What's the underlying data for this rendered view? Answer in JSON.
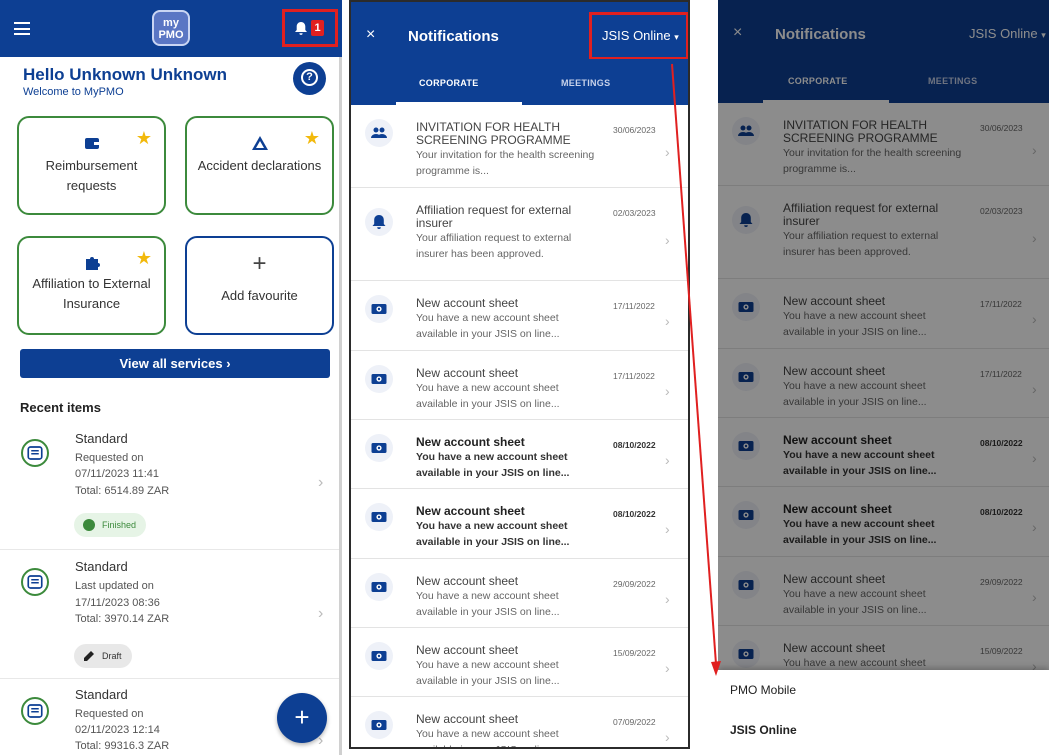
{
  "home": {
    "logo": [
      "my",
      "PMO"
    ],
    "notification_count": "1",
    "greeting": "Hello Unknown Unknown",
    "welcome": "Welcome to MyPMO",
    "help_label": "?",
    "tiles": [
      {
        "label": "Reimbursement requests",
        "icon": "wallet-icon",
        "starred": true
      },
      {
        "label": "Accident declarations",
        "icon": "accident-icon",
        "starred": true
      },
      {
        "label": "Affiliation to External Insurance",
        "icon": "puzzle-icon",
        "starred": true
      },
      {
        "label": "Add favourite",
        "icon": "plus-icon",
        "starred": false
      }
    ],
    "view_all": "View all services  ›",
    "recent_title": "Recent items",
    "recent_items": [
      {
        "title": "Standard",
        "line1": "Requested on",
        "line2": "07/11/2023 11:41",
        "line3": "Total: 6514.89 ZAR",
        "status": "Finished"
      },
      {
        "title": "Standard",
        "line1": "Last updated on",
        "line2": "17/11/2023 08:36",
        "line3": "Total: 3970.14 ZAR",
        "status": "Draft"
      },
      {
        "title": "Standard",
        "line1": "Requested on",
        "line2": "02/11/2023 12:14",
        "line3": "Total: 99316.3 ZAR",
        "status": ""
      }
    ],
    "fab": "+"
  },
  "notifications": {
    "close": "×",
    "title": "Notifications",
    "source": "JSIS Online",
    "tabs": [
      "CORPORATE",
      "MEETINGS"
    ],
    "items": [
      {
        "icon": "group-icon",
        "title": "INVITATION FOR HEALTH SCREENING PROGRAMME",
        "body": "Your invitation for the health screening programme is...",
        "date": "30/06/2023",
        "unread": false
      },
      {
        "icon": "bell-icon",
        "title": "Affiliation request for external insurer",
        "body": "Your affiliation request to external insurer has been approved.",
        "date": "02/03/2023",
        "unread": false
      },
      {
        "icon": "money-icon",
        "title": "New account sheet",
        "body": "You have a new account sheet available in your JSIS on line...",
        "date": "17/11/2022",
        "unread": false
      },
      {
        "icon": "money-icon",
        "title": "New account sheet",
        "body": "You have a new account sheet available in your JSIS on line...",
        "date": "17/11/2022",
        "unread": false
      },
      {
        "icon": "money-icon",
        "title": "New account sheet",
        "body": "You have a new account sheet available in your JSIS on line...",
        "date": "08/10/2022",
        "unread": true
      },
      {
        "icon": "money-icon",
        "title": "New account sheet",
        "body": "You have a new account sheet available in your JSIS on line...",
        "date": "08/10/2022",
        "unread": true
      },
      {
        "icon": "money-icon",
        "title": "New account sheet",
        "body": "You have a new account sheet available in your JSIS on line...",
        "date": "29/09/2022",
        "unread": false
      },
      {
        "icon": "money-icon",
        "title": "New account sheet",
        "body": "You have a new account sheet available in your JSIS on line...",
        "date": "15/09/2022",
        "unread": false
      },
      {
        "icon": "money-icon",
        "title": "New account sheet",
        "body": "You have a new account sheet available in your JSIS on line...",
        "date": "07/09/2022",
        "unread": false
      }
    ]
  },
  "source_menu": {
    "options": [
      "PMO Mobile",
      "JSIS Online"
    ],
    "selected": "JSIS Online"
  },
  "colors": {
    "primary": "#0d3f93",
    "accent_green": "#3c8a3c",
    "star": "#f2b90c",
    "highlight": "#e02020"
  }
}
